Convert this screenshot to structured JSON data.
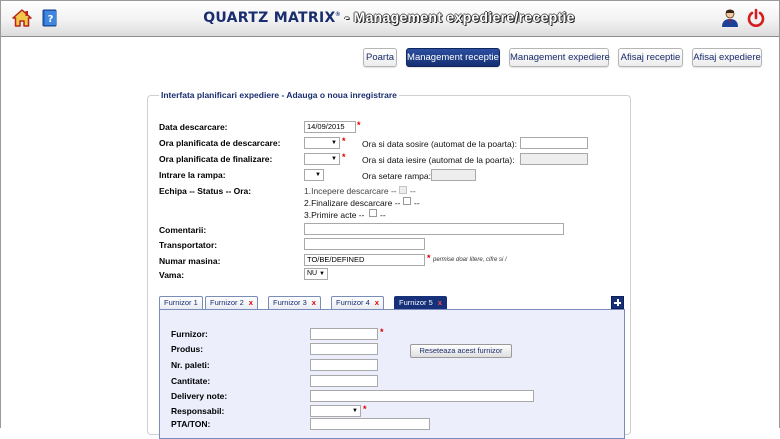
{
  "header": {
    "brand": "QUARTZ MATRIX",
    "subtitle": " - Management expediere/receptie"
  },
  "nav": {
    "poarta": "Poarta",
    "management_receptie": "Management receptie",
    "management_expediere": "Management expediere",
    "afisaj_receptie": "Afisaj receptie",
    "afisaj_expediere": "Afisaj expediere"
  },
  "form": {
    "title": "Interfata planificari expediere - Adauga o noua inregistrare",
    "data_descarcare_label": "Data descarcare:",
    "data_descarcare_value": "14/09/2015",
    "ora_planificata_descarcare_label": "Ora planificata de descarcare:",
    "ora_sosire_label": "Ora si data sosire (automat de la poarta):",
    "ora_planificata_finalizare_label": "Ora planificata de finalizare:",
    "ora_iesire_label": "Ora si data iesire (automat de la poarta):",
    "intrare_rampa_label": "Intrare la rampa:",
    "ora_setare_rampa_label": "Ora setare rampa:",
    "echipa_label": "Echipa -- Status -- Ora:",
    "status1": "1.Incepere descarcare -- ",
    "status2": "2.Finalizare descarcare -- ",
    "status3": "3.Primire acte -- ",
    "status_dash": "--",
    "comentarii_label": "Comentarii:",
    "transportator_label": "Transportator:",
    "numar_masina_label": "Numar masina:",
    "numar_masina_value": "TO/BE/DEFINED",
    "numar_masina_hint": "permise doar litere, cifre si /",
    "vama_label": "Vama:",
    "vama_value": "NU",
    "required_mark": "*"
  },
  "tabs": [
    {
      "label": "Furnizor 1",
      "close": ""
    },
    {
      "label": "Furnizor 2",
      "close": "x"
    },
    {
      "label": "Furnizor 3",
      "close": "x"
    },
    {
      "label": "Furnizor 4",
      "close": "x"
    },
    {
      "label": "Furnizor 5",
      "close": "x"
    }
  ],
  "supplier": {
    "furnizor_label": "Furnizor:",
    "produs_label": "Produs:",
    "nr_paleti_label": "Nr. paleti:",
    "cantitate_label": "Cantitate:",
    "delivery_note_label": "Delivery note:",
    "responsabil_label": "Responsabil:",
    "pta_ton_label": "PTA/TON:",
    "reset_button": "Reseteaza acest furnizor"
  },
  "colors": {
    "navy": "#1a2d6e",
    "active_tab": "#16307a",
    "required": "#dd0000",
    "tab_panel_bg": "#eceefc"
  }
}
